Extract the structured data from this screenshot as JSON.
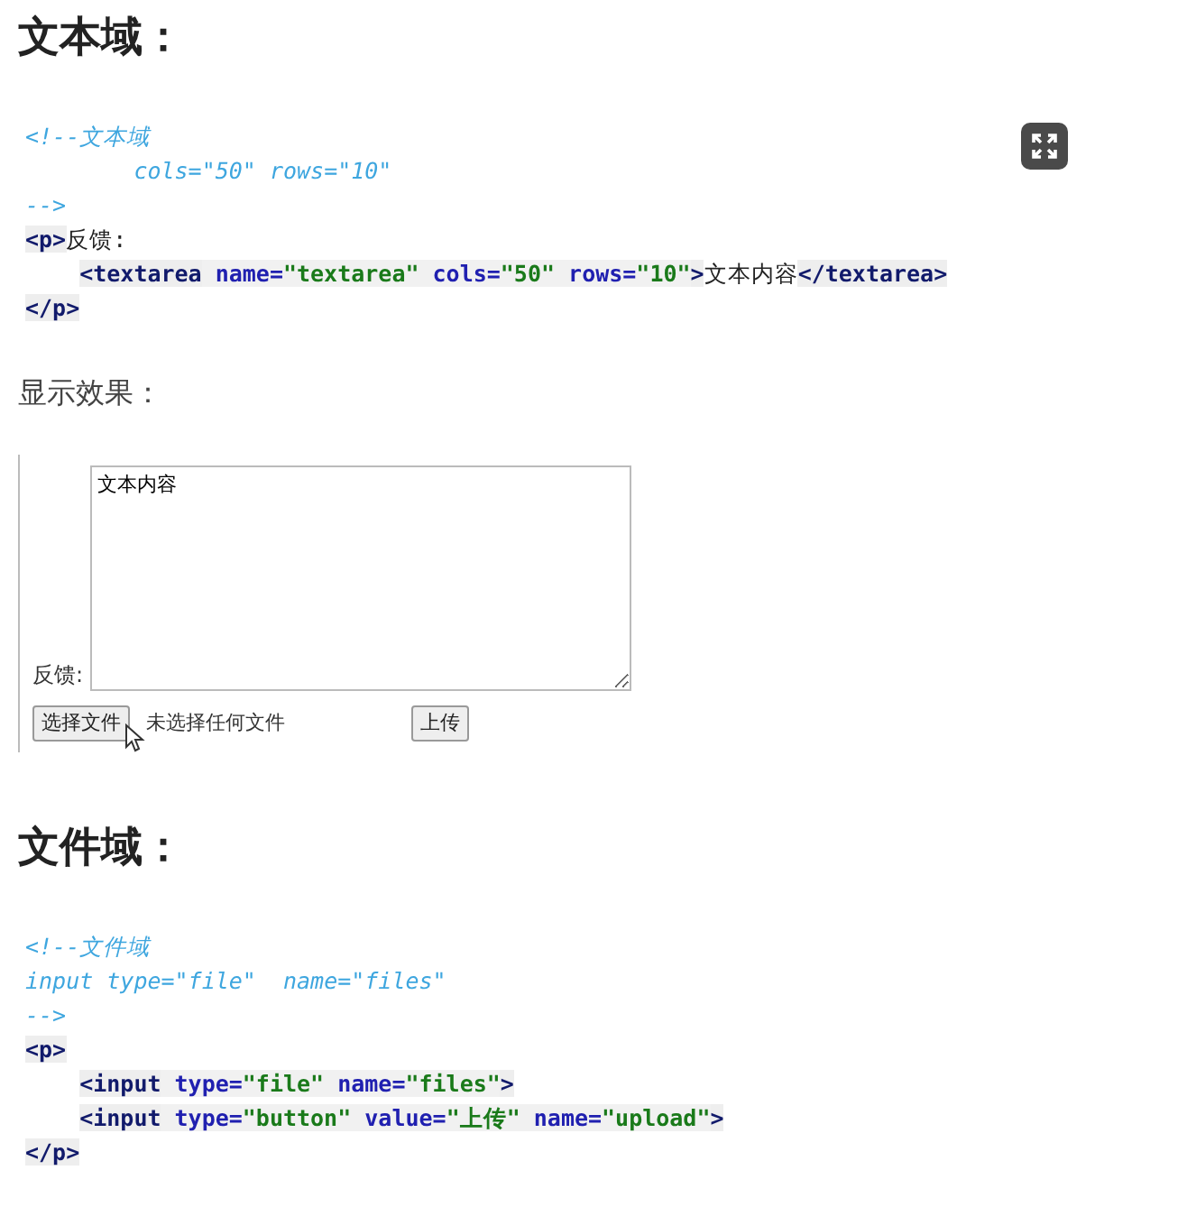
{
  "sections": [
    {
      "heading": "文本域：",
      "expand_button": true,
      "code_lines": [
        {
          "indent": false,
          "tokens": [
            {
              "kind": "comment",
              "text": "<!--文本域"
            }
          ]
        },
        {
          "indent": false,
          "tokens": [
            {
              "kind": "comment",
              "text": "        cols=\"50\" rows=\"10\""
            }
          ]
        },
        {
          "indent": false,
          "tokens": [
            {
              "kind": "comment",
              "text": "-->"
            }
          ]
        },
        {
          "indent": false,
          "tokens": [
            {
              "kind": "tag",
              "text": "<p>"
            },
            {
              "kind": "text",
              "text": "反馈:"
            }
          ]
        },
        {
          "indent": true,
          "tokens": [
            {
              "kind": "tag",
              "text": "<textarea"
            },
            {
              "kind": "attr",
              "text": " name="
            },
            {
              "kind": "value",
              "text": "\"textarea\""
            },
            {
              "kind": "attr",
              "text": " cols="
            },
            {
              "kind": "value",
              "text": "\"50\""
            },
            {
              "kind": "attr",
              "text": " rows="
            },
            {
              "kind": "value",
              "text": "\"10\""
            },
            {
              "kind": "tag",
              "text": ">"
            },
            {
              "kind": "text",
              "text": "文本内容"
            },
            {
              "kind": "tag",
              "text": "</textarea>"
            }
          ]
        },
        {
          "indent": false,
          "tokens": [
            {
              "kind": "tag",
              "text": "</p>"
            }
          ]
        }
      ],
      "caption": "显示效果：",
      "demo": {
        "label": "反馈:",
        "textarea_value": "文本内容",
        "file_button": "选择文件",
        "file_status": "未选择任何文件",
        "upload_button": "上传"
      }
    },
    {
      "heading": "文件域：",
      "code_lines": [
        {
          "indent": false,
          "tokens": [
            {
              "kind": "comment",
              "text": "<!--文件域"
            }
          ]
        },
        {
          "indent": false,
          "tokens": [
            {
              "kind": "comment",
              "text": "input type=\"file\"  name=\"files\""
            }
          ]
        },
        {
          "indent": false,
          "tokens": [
            {
              "kind": "comment",
              "text": "-->"
            }
          ]
        },
        {
          "indent": false,
          "tokens": [
            {
              "kind": "tag",
              "text": "<p>"
            }
          ]
        },
        {
          "indent": true,
          "tokens": [
            {
              "kind": "tag",
              "text": "<input"
            },
            {
              "kind": "attr",
              "text": " type="
            },
            {
              "kind": "value",
              "text": "\"file\""
            },
            {
              "kind": "attr",
              "text": " name="
            },
            {
              "kind": "value",
              "text": "\"files\""
            },
            {
              "kind": "tag",
              "text": ">"
            }
          ]
        },
        {
          "indent": true,
          "tokens": [
            {
              "kind": "tag",
              "text": "<input"
            },
            {
              "kind": "attr",
              "text": " type="
            },
            {
              "kind": "value",
              "text": "\"button\""
            },
            {
              "kind": "attr",
              "text": " value="
            },
            {
              "kind": "value",
              "text": "\"上传\""
            },
            {
              "kind": "attr",
              "text": " name="
            },
            {
              "kind": "value",
              "text": "\"upload\""
            },
            {
              "kind": "tag",
              "text": ">"
            }
          ]
        },
        {
          "indent": false,
          "tokens": [
            {
              "kind": "tag",
              "text": "</p>"
            }
          ]
        }
      ]
    }
  ]
}
